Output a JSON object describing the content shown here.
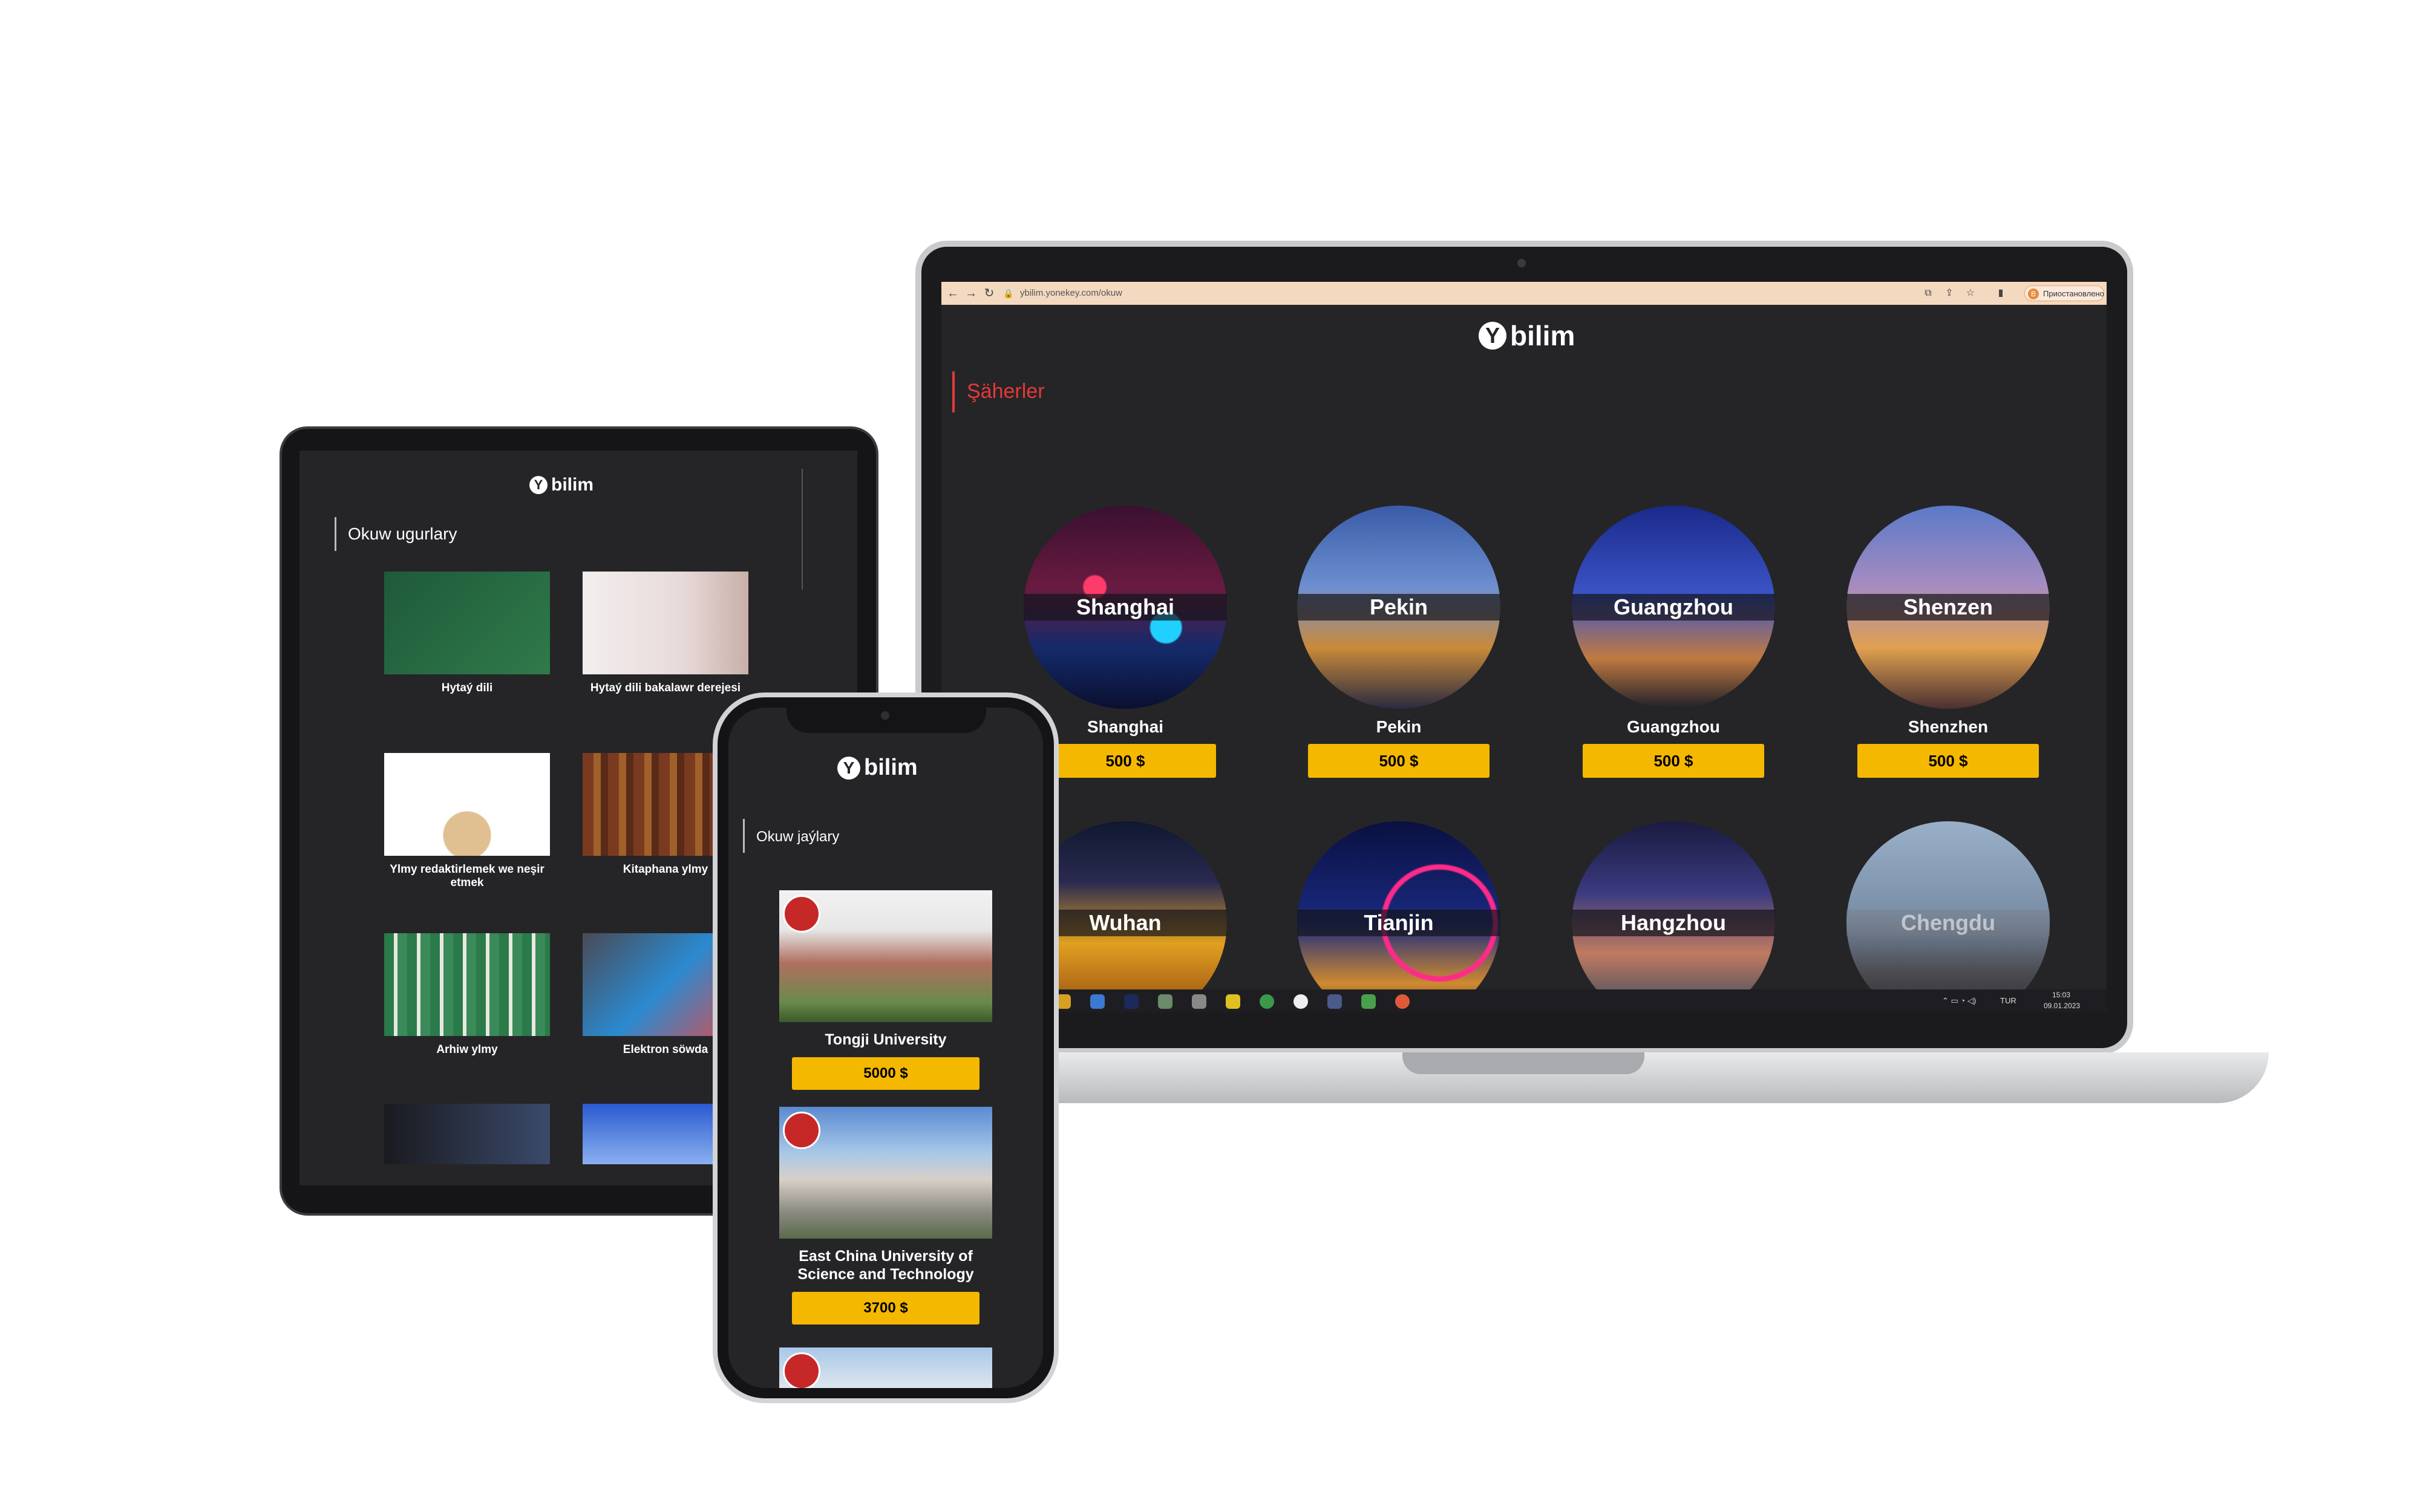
{
  "laptop": {
    "browser": {
      "url": "ybilim.yonekey.com/okuw",
      "update_label": "Приостановлено",
      "profile_initial": "В"
    },
    "brand": "bilim",
    "brand_mark": "Y",
    "section_title": "Şäherler",
    "cities": [
      {
        "band": "Shanghai",
        "name": "Shanghai",
        "price": "500 $"
      },
      {
        "band": "Pekin",
        "name": "Pekin",
        "price": "500 $"
      },
      {
        "band": "Guangzhou",
        "name": "Guangzhou",
        "price": "500 $"
      },
      {
        "band": "Shenzen",
        "name": "Shenzhen",
        "price": "500 $"
      },
      {
        "band": "Wuhan"
      },
      {
        "band": "Tianjin"
      },
      {
        "band": "Hangzhou"
      },
      {
        "band": "Chengdu"
      }
    ],
    "taskbar": {
      "lang": "TUR",
      "time": "15:03",
      "date": "09.01.2023"
    }
  },
  "tablet": {
    "brand": "bilim",
    "brand_mark": "Y",
    "section_title": "Okuw ugurlary",
    "cards": [
      {
        "label": "Hytaý dili"
      },
      {
        "label": "Hytaý dili bakalawr derejesi"
      },
      {
        "label": "Ylmy redaktirlemek we neşir etmek"
      },
      {
        "label": "Kitaphana ylmy"
      },
      {
        "label": "Arhiw ylmy"
      },
      {
        "label": "Elektron söwda"
      }
    ]
  },
  "phone": {
    "brand": "bilim",
    "brand_mark": "Y",
    "section_title": "Okuw jaýlary",
    "universities": [
      {
        "name": "Tongji University",
        "price": "5000 $"
      },
      {
        "name": "East China University of Science and Technology",
        "price": "3700 $"
      }
    ]
  },
  "colors": {
    "accent_red": "#e53935",
    "price_yellow": "#f5b800",
    "screen_bg": "#252528"
  }
}
